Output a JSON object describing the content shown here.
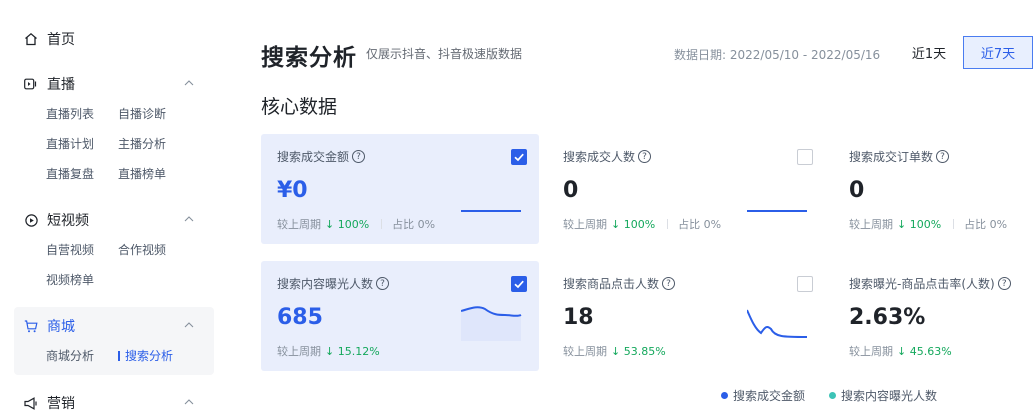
{
  "sidebar": {
    "home": "首页",
    "sections": [
      {
        "key": "live",
        "title": "直播",
        "icon": "live-icon",
        "items": [
          "直播列表",
          "自播诊断",
          "直播计划",
          "主播分析",
          "直播复盘",
          "直播榜单"
        ]
      },
      {
        "key": "video",
        "title": "短视频",
        "icon": "video-icon",
        "items": [
          "自营视频",
          "合作视频",
          "视频榜单"
        ]
      },
      {
        "key": "mall",
        "title": "商城",
        "icon": "cart-icon",
        "items": [
          "商城分析",
          "搜索分析"
        ],
        "active_item": "搜索分析"
      },
      {
        "key": "marketing",
        "title": "营销",
        "icon": "megaphone-icon",
        "items": []
      }
    ]
  },
  "header": {
    "title": "搜索分析",
    "subtitle": "仅展示抖音、抖音极速版数据",
    "date_label": "数据日期:  2022/05/10 - 2022/05/16",
    "range_1d": "近1天",
    "range_7d": "近7天",
    "selected_range": "近7天"
  },
  "core": {
    "title": "核心数据",
    "compare_label": "较上周期",
    "share_label": "占比",
    "cards": [
      {
        "label": "搜索成交金额",
        "value": "¥0",
        "change": "100%",
        "direction": "down",
        "share": "0%",
        "checked": true
      },
      {
        "label": "搜索成交人数",
        "value": "0",
        "change": "100%",
        "direction": "down",
        "share": "0%",
        "checked": false
      },
      {
        "label": "搜索成交订单数",
        "value": "0",
        "change": "100%",
        "direction": "down",
        "share": "0%",
        "checked": false
      },
      {
        "label": "搜索内容曝光人数",
        "value": "685",
        "change": "15.12%",
        "direction": "down",
        "checked": true
      },
      {
        "label": "搜索商品点击人数",
        "value": "18",
        "change": "53.85%",
        "direction": "down",
        "checked": false
      },
      {
        "label": "搜索曝光-商品点击率(人数)",
        "value": "2.63%",
        "change": "45.63%",
        "direction": "down",
        "checked": false
      }
    ]
  },
  "legend": [
    {
      "label": "搜索成交金额",
      "color": "#2b5ee8"
    },
    {
      "label": "搜索内容曝光人数",
      "color": "#3cc3b6"
    }
  ]
}
